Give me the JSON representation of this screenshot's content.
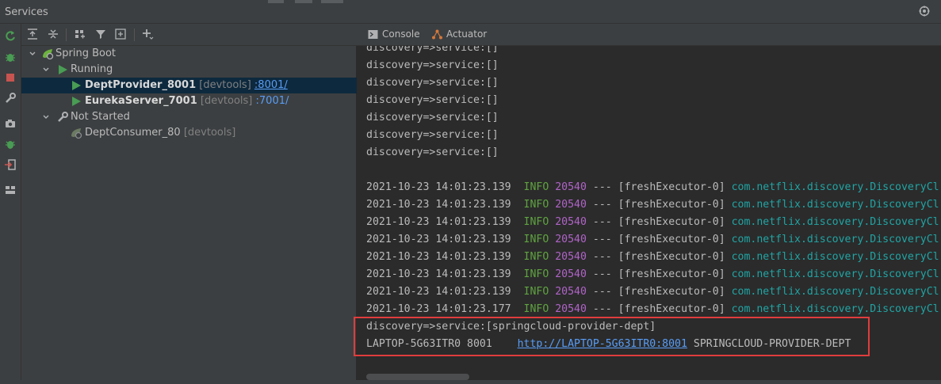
{
  "window": {
    "title": "Services"
  },
  "tree": {
    "root": {
      "label": "Spring Boot"
    },
    "running_group": {
      "label": "Running"
    },
    "not_started_group": {
      "label": "Not Started"
    },
    "items": [
      {
        "name": "DeptProvider_8001",
        "tag": "[devtools]",
        "port": ":8001/",
        "state": "running"
      },
      {
        "name": "EurekaServer_7001",
        "tag": "[devtools]",
        "port": ":7001/",
        "state": "running"
      },
      {
        "name": "DeptConsumer_80",
        "tag": "[devtools]",
        "state": "not-started"
      }
    ]
  },
  "tabs": [
    {
      "label": "Console",
      "icon": "console-icon"
    },
    {
      "label": "Actuator",
      "icon": "actuator-icon"
    }
  ],
  "console": {
    "discovery_lines": [
      "discovery=>service:[]",
      "discovery=>service:[]",
      "discovery=>service:[]",
      "discovery=>service:[]",
      "discovery=>service:[]",
      "discovery=>service:[]",
      "discovery=>service:[]"
    ],
    "log_lines": [
      {
        "ts": "2021-10-23 14:01:23.139",
        "level": "INFO",
        "pid": "20540",
        "sep": "---",
        "thread": "[freshExecutor-0]",
        "cls": "com.netflix.discovery.DiscoveryCl"
      },
      {
        "ts": "2021-10-23 14:01:23.139",
        "level": "INFO",
        "pid": "20540",
        "sep": "---",
        "thread": "[freshExecutor-0]",
        "cls": "com.netflix.discovery.DiscoveryCl"
      },
      {
        "ts": "2021-10-23 14:01:23.139",
        "level": "INFO",
        "pid": "20540",
        "sep": "---",
        "thread": "[freshExecutor-0]",
        "cls": "com.netflix.discovery.DiscoveryCl"
      },
      {
        "ts": "2021-10-23 14:01:23.139",
        "level": "INFO",
        "pid": "20540",
        "sep": "---",
        "thread": "[freshExecutor-0]",
        "cls": "com.netflix.discovery.DiscoveryCl"
      },
      {
        "ts": "2021-10-23 14:01:23.139",
        "level": "INFO",
        "pid": "20540",
        "sep": "---",
        "thread": "[freshExecutor-0]",
        "cls": "com.netflix.discovery.DiscoveryCl"
      },
      {
        "ts": "2021-10-23 14:01:23.139",
        "level": "INFO",
        "pid": "20540",
        "sep": "---",
        "thread": "[freshExecutor-0]",
        "cls": "com.netflix.discovery.DiscoveryCl"
      },
      {
        "ts": "2021-10-23 14:01:23.139",
        "level": "INFO",
        "pid": "20540",
        "sep": "---",
        "thread": "[freshExecutor-0]",
        "cls": "com.netflix.discovery.DiscoveryCl"
      },
      {
        "ts": "2021-10-23 14:01:23.177",
        "level": "INFO",
        "pid": "20540",
        "sep": "---",
        "thread": "[freshExecutor-0]",
        "cls": "com.netflix.discovery.DiscoveryCl"
      }
    ],
    "final_service_line": "discovery=>service:[springcloud-provider-dept]",
    "instance_line": {
      "host_port": "LAPTOP-5G63ITR0 8001",
      "url": "http://LAPTOP-5G63ITR0:8001",
      "app": "SPRINGCLOUD-PROVIDER-DEPT"
    }
  },
  "colors": {
    "run_green": "#499c54",
    "stop_red": "#c75450",
    "info_green": "#5fa340",
    "pid_magenta": "#b064c8",
    "class_cyan": "#21a4a4",
    "highlight_red": "#e03c3c",
    "selection": "#0d293e",
    "link_blue": "#589df6"
  }
}
